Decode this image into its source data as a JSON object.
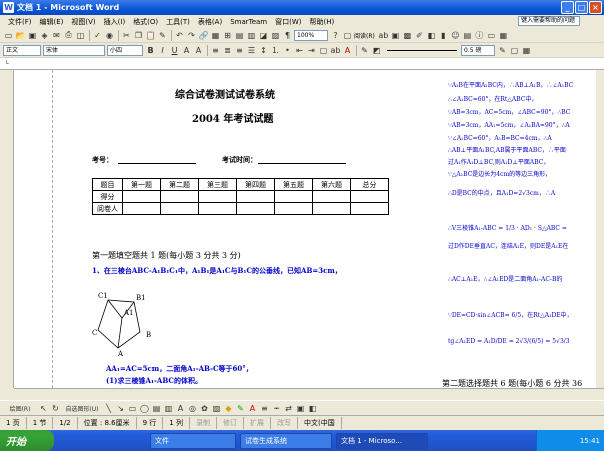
{
  "window": {
    "title": "文档 1 - Microsoft Word"
  },
  "menu": {
    "items": [
      "文件(F)",
      "编辑(E)",
      "视图(V)",
      "插入(I)",
      "格式(O)",
      "工具(T)",
      "表格(A)",
      "SmarTeam",
      "窗口(W)",
      "帮助(H)"
    ],
    "help_box": "键入需要帮助的问题"
  },
  "toolbar1": {
    "zoom": "100%",
    "read": "阅读(R)"
  },
  "toolbar2": {
    "style": "正文",
    "font": "宋体",
    "size": "小四",
    "bold": "B",
    "italic": "I",
    "underline": "U",
    "linewidth": "0.5 磅"
  },
  "doc": {
    "title": "综合试卷测试试卷系统",
    "subtitle": "2004 年考试试题",
    "exam_no_label": "考号：",
    "exam_time_label": "考试时间：",
    "table": {
      "header": [
        "题目",
        "第一题",
        "第二题",
        "第三题",
        "第四题",
        "第五题",
        "第六题",
        "总分"
      ],
      "rows": [
        [
          "得分",
          "",
          "",
          "",
          "",
          "",
          "",
          ""
        ],
        [
          "阅卷人",
          "",
          "",
          "",
          "",
          "",
          "",
          ""
        ]
      ]
    },
    "section1": "第一题填空题共 1 题(每小题 3 分共 3 分)",
    "q1": "1、在三棱台ABC-A₁B₁C₁中，A₁B₁是A₁C与B₁C的公垂线，已知AB=3cm，",
    "fig": {
      "C1": "C1",
      "B1": "B1",
      "A1": "A1",
      "C": "C",
      "B": "B",
      "A": "A"
    },
    "q1b": "AA₁=AC=5cm，二面角A₁-AB-C等于60°，",
    "q1c": "(1)求三棱锥A₁-ABC的体积。",
    "right": [
      "∵A₁B在平面A₁BC内，∴AB⊥A₁B，∴∠A₁BC",
      "∴∠A₁BC=60°，在Rt△ABC中，",
      "∵AB=3cm，AC=5cm，∠ABC=90°，∴BC",
      "∵AB=3cm，AA₁=5cm，∠A₁BA=90°，∴A",
      "∵∠A₁BC=60°，A₁B=BC=4cm，∴A",
      "∴AB⊥平面A₁BC,AB属于平面ABC，∴平面",
      "过A₁作A₁D⊥BC,则A₁D⊥平面ABC，",
      "∵△A₁BC是边长为4cm的等边三角形，",
      "∴D是BC的中点，且A₁D=2√3cm，∴A",
      "∴V三棱锥A₁-ABC = 1/3 · AD₁ · S△ABC =",
      "过D作DE垂直AC，连结A₁E，则DE是A₁E在",
      "∴AC⊥A₁E，∴∠A₁ED是二面角A₁-AC-B的",
      "∵DE=CD·sin∠ACB= 6/5，在Rt△A₁DE中，",
      "tg∠A₁ED = A₁D/DE = 2√3/(6/5) = 5√3/3",
      "第二题选择题共 6 题(每小题 6 分共 36"
    ]
  },
  "status": {
    "page": "1 页",
    "section": "1 节",
    "pages": "1/2",
    "pos": "位置 : 8.6厘米",
    "line": "9 行",
    "col": "1 列",
    "rec": "录制",
    "trk": "修订",
    "ext": "扩展",
    "ovr": "改写",
    "lang": "中文(中国"
  },
  "taskbar": {
    "start": "开始",
    "tasks": [
      "文件",
      "试卷生成系统",
      "文档 1 - Microso..."
    ],
    "time": "15:41"
  }
}
